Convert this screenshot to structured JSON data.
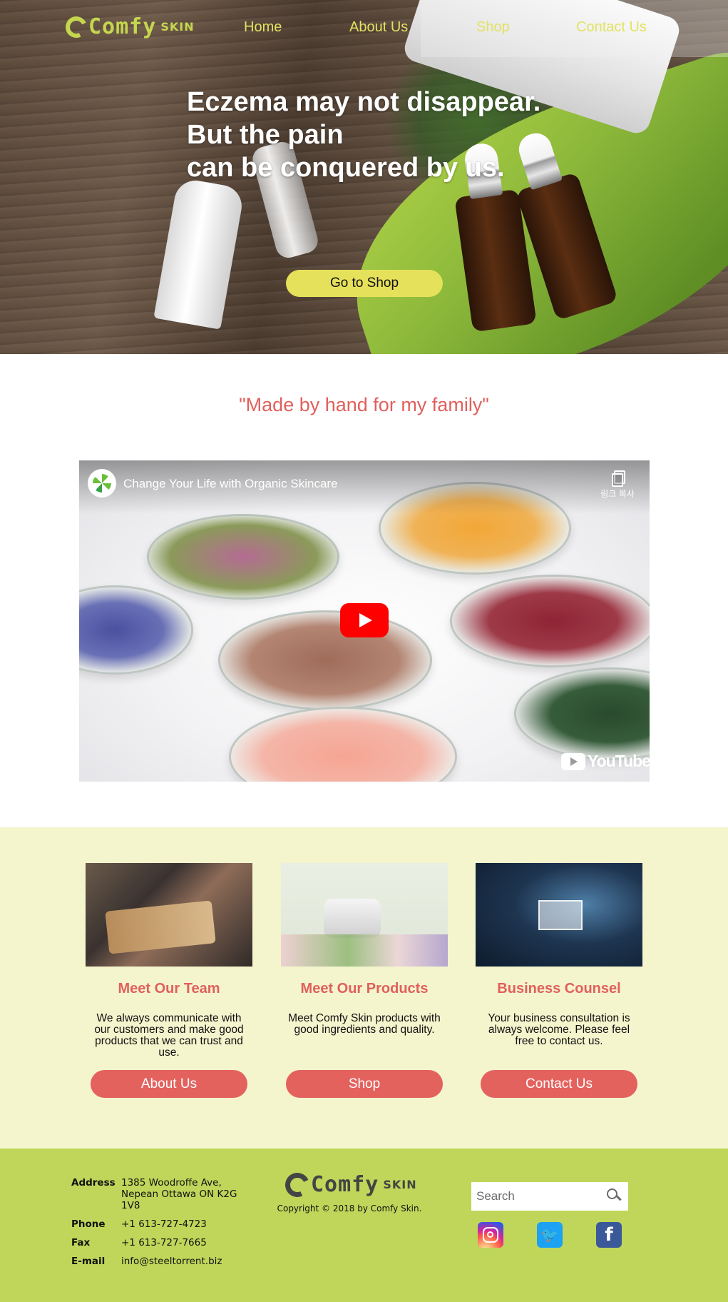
{
  "brand": {
    "logo_word": "Comfy",
    "logo_suffix": "SKIN",
    "colors": {
      "nav_text": "#e2e262",
      "accent_red": "#e0605c",
      "footer_bg": "#bfd65a",
      "features_bg": "#f4f4cd",
      "shop_button": "#e6e15a"
    }
  },
  "nav": {
    "items": [
      {
        "label": "Home"
      },
      {
        "label": "About Us"
      },
      {
        "label": "Shop"
      },
      {
        "label": "Contact Us"
      }
    ]
  },
  "hero": {
    "headline_lines": [
      "Eczema may not disappear.",
      "But the pain",
      "can be conquered by us."
    ],
    "cta_label": "Go to Shop"
  },
  "quote": "\"Made by hand for my family\"",
  "video": {
    "title": "Change Your Life with Organic Skincare",
    "copy_link_label": "링크 복사",
    "provider": "YouTube",
    "icons": {
      "channel": "channel-avatar-icon",
      "copy": "copy-link-icon",
      "play": "play-icon"
    }
  },
  "features": [
    {
      "title": "Meet Our Team",
      "text": "We always communicate with our customers and make good products that we can trust and use.",
      "button": "About Us"
    },
    {
      "title": "Meet Our Products",
      "text": "Meet Comfy Skin products with good ingredients and quality.",
      "button": "Shop"
    },
    {
      "title": "Business Counsel",
      "text": "Your business consultation is always welcome. Please feel free to contact us.",
      "button": "Contact Us"
    }
  ],
  "footer": {
    "contact": [
      {
        "label": "Address",
        "value": "1385 Woodroffe Ave, Nepean Ottawa ON K2G 1V8"
      },
      {
        "label": "Phone",
        "value": "+1 613-727-4723"
      },
      {
        "label": "Fax",
        "value": "+1 613-727-7665"
      },
      {
        "label": "E-mail",
        "value": "info@steeltorrent.biz"
      }
    ],
    "copyright": "Copyright © 2018 by Comfy Skin.",
    "search_placeholder": "Search",
    "social": [
      {
        "name": "instagram-icon",
        "glyph": ""
      },
      {
        "name": "twitter-icon",
        "glyph": "🐦"
      },
      {
        "name": "facebook-icon",
        "glyph": "f"
      }
    ]
  }
}
